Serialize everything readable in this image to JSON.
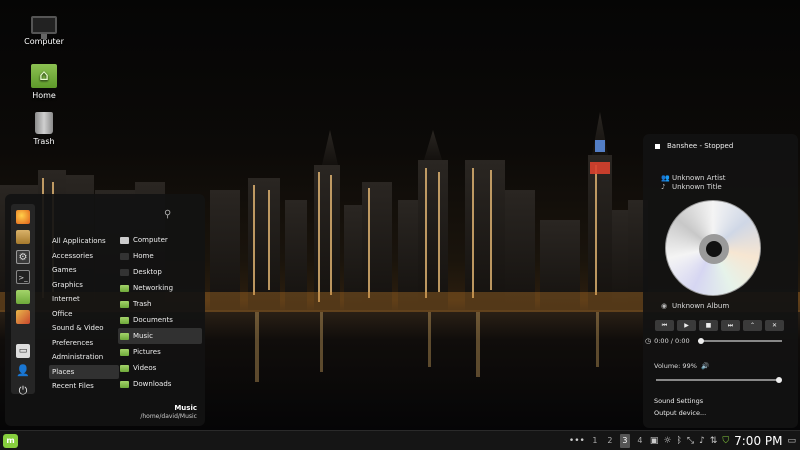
{
  "desktop": {
    "icons": [
      {
        "label": "Computer"
      },
      {
        "label": "Home"
      },
      {
        "label": "Trash"
      }
    ]
  },
  "menu": {
    "search": {
      "placeholder": ""
    },
    "favorites": [
      {
        "icon": "firefox-icon"
      },
      {
        "icon": "software-manager-icon"
      },
      {
        "icon": "system-settings-icon"
      },
      {
        "icon": "terminal-icon"
      },
      {
        "icon": "files-icon"
      },
      {
        "icon": "image-viewer-icon"
      },
      {
        "icon": "lock-screen-icon"
      },
      {
        "icon": "logout-icon"
      },
      {
        "icon": "power-icon"
      }
    ],
    "categories": [
      "All Applications",
      "Accessories",
      "Games",
      "Graphics",
      "Internet",
      "Office",
      "Sound & Video",
      "Preferences",
      "Administration",
      "Places",
      "Recent Files"
    ],
    "active_category": "Places",
    "places": [
      "Computer",
      "Home",
      "Desktop",
      "Networking",
      "Trash",
      "Documents",
      "Music",
      "Pictures",
      "Videos",
      "Downloads"
    ],
    "active_place": "Music",
    "selected": {
      "title": "Music",
      "path": "/home/david/Music"
    }
  },
  "sound_applet": {
    "player_title": "Banshee - Stopped",
    "artist": "Unknown Artist",
    "track": "Unknown Title",
    "album": "Unknown Album",
    "controls": [
      "⏮",
      "▶",
      "■",
      "⏭",
      "⌃",
      "✕"
    ],
    "time": "0:00 / 0:00",
    "position_fraction": 0,
    "volume_label": "Volume: 99%",
    "volume_fraction": 0.99,
    "menu": [
      "Sound Settings",
      "Output device..."
    ]
  },
  "taskbar": {
    "overflow": "•••",
    "workspaces": [
      "1",
      "2",
      "3",
      "4"
    ],
    "active_workspace": "3",
    "clock": "7:00 PM"
  },
  "colors": {
    "accent": "#87cf3e",
    "panel": "#151515",
    "menu_bg": "#121212"
  }
}
